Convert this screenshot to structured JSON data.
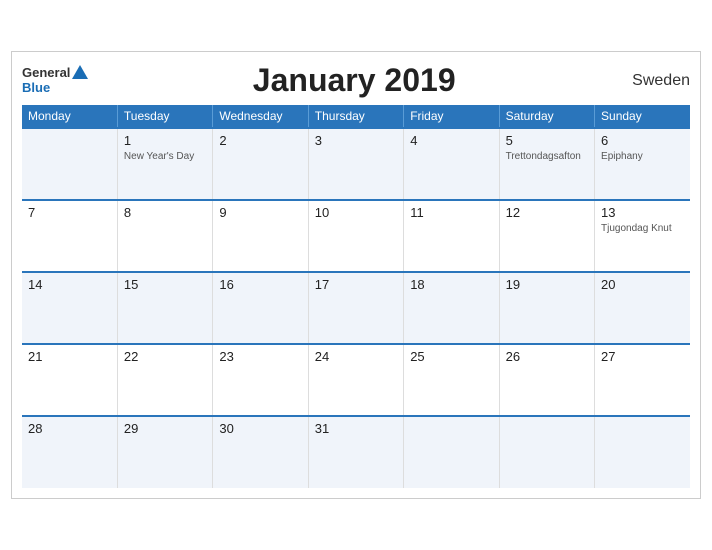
{
  "header": {
    "title": "January 2019",
    "country": "Sweden",
    "logo": {
      "general": "General",
      "blue": "Blue"
    }
  },
  "weekdays": [
    "Monday",
    "Tuesday",
    "Wednesday",
    "Thursday",
    "Friday",
    "Saturday",
    "Sunday"
  ],
  "weeks": [
    [
      {
        "day": "",
        "holiday": ""
      },
      {
        "day": "1",
        "holiday": "New Year's Day"
      },
      {
        "day": "2",
        "holiday": ""
      },
      {
        "day": "3",
        "holiday": ""
      },
      {
        "day": "4",
        "holiday": ""
      },
      {
        "day": "5",
        "holiday": "Trettondagsafton"
      },
      {
        "day": "6",
        "holiday": "Epiphany"
      }
    ],
    [
      {
        "day": "7",
        "holiday": ""
      },
      {
        "day": "8",
        "holiday": ""
      },
      {
        "day": "9",
        "holiday": ""
      },
      {
        "day": "10",
        "holiday": ""
      },
      {
        "day": "11",
        "holiday": ""
      },
      {
        "day": "12",
        "holiday": ""
      },
      {
        "day": "13",
        "holiday": "Tjugondag Knut"
      }
    ],
    [
      {
        "day": "14",
        "holiday": ""
      },
      {
        "day": "15",
        "holiday": ""
      },
      {
        "day": "16",
        "holiday": ""
      },
      {
        "day": "17",
        "holiday": ""
      },
      {
        "day": "18",
        "holiday": ""
      },
      {
        "day": "19",
        "holiday": ""
      },
      {
        "day": "20",
        "holiday": ""
      }
    ],
    [
      {
        "day": "21",
        "holiday": ""
      },
      {
        "day": "22",
        "holiday": ""
      },
      {
        "day": "23",
        "holiday": ""
      },
      {
        "day": "24",
        "holiday": ""
      },
      {
        "day": "25",
        "holiday": ""
      },
      {
        "day": "26",
        "holiday": ""
      },
      {
        "day": "27",
        "holiday": ""
      }
    ],
    [
      {
        "day": "28",
        "holiday": ""
      },
      {
        "day": "29",
        "holiday": ""
      },
      {
        "day": "30",
        "holiday": ""
      },
      {
        "day": "31",
        "holiday": ""
      },
      {
        "day": "",
        "holiday": ""
      },
      {
        "day": "",
        "holiday": ""
      },
      {
        "day": "",
        "holiday": ""
      }
    ]
  ]
}
